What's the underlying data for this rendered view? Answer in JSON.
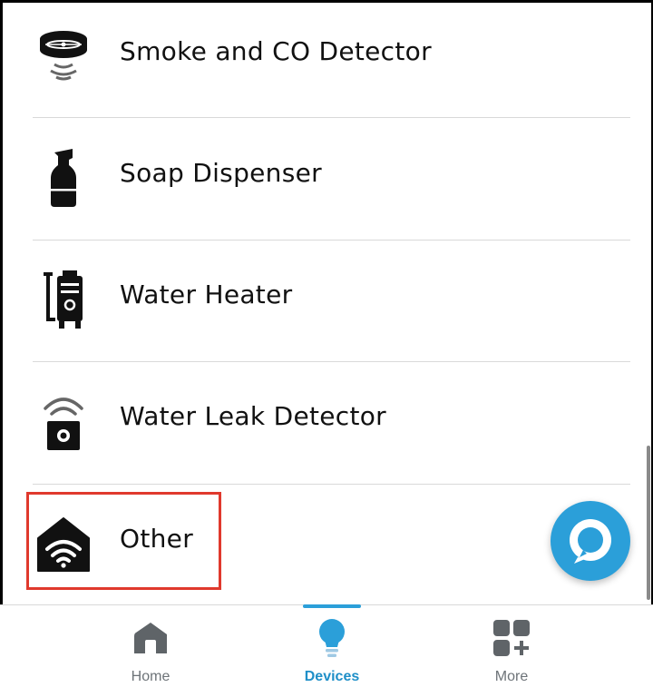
{
  "devices": [
    {
      "label": "Smoke and CO Detector",
      "icon": "smoke-detector-icon"
    },
    {
      "label": "Soap Dispenser",
      "icon": "soap-dispenser-icon"
    },
    {
      "label": "Water Heater",
      "icon": "water-heater-icon"
    },
    {
      "label": "Water Leak Detector",
      "icon": "water-leak-detector-icon"
    },
    {
      "label": "Other",
      "icon": "other-device-icon"
    }
  ],
  "tabs": [
    {
      "label": "Home",
      "icon": "home-icon"
    },
    {
      "label": "Devices",
      "icon": "devices-bulb-icon",
      "active": true
    },
    {
      "label": "More",
      "icon": "more-grid-icon"
    }
  ],
  "colors": {
    "accent": "#2b9fd9",
    "active_tab_text": "#1f8fc8",
    "highlight_box": "#e0392d",
    "inactive_tab": "#6d7378"
  }
}
